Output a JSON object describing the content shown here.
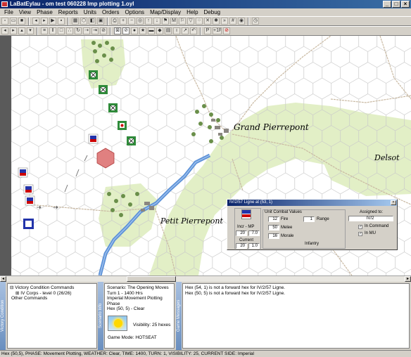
{
  "window": {
    "title": "LaBatEylau - om test 060228 Imp plotting 1.oyl"
  },
  "menu": [
    "File",
    "View",
    "Phase",
    "Reports",
    "Units",
    "Orders",
    "Options",
    "Map/Display",
    "Help",
    "Debug"
  ],
  "toolbar2": {
    "p_label": "P",
    "plus_label": "+1P"
  },
  "map": {
    "places": [
      {
        "name": "Grand Pierrepont"
      },
      {
        "name": "Petit Pierrepont"
      },
      {
        "name": "Delsot"
      }
    ],
    "colors": {
      "hex_bg": "#ffffff",
      "hex_line": "#c8c8c8",
      "woods": "#e2efc6",
      "river": "#5f93d8",
      "road": "#c9b9a2",
      "unit_green": "#2f8b3a",
      "french_blue": "#2233aa",
      "hex_highlight": "#e08080"
    }
  },
  "unit_dialog": {
    "title": "IV/2/57 Ligne at (53, 1)",
    "combat_values_label": "Unit Combat Values",
    "fire_value": "12",
    "fire_label": "Fire",
    "range_value": "1",
    "range_label": "Range",
    "melee_value": "50",
    "melee_label": "Melee",
    "morale_value": "16",
    "morale_label": "Morale",
    "type_label": "Infantry",
    "incr_mp_label": "Incr - MP",
    "incr_value": "20",
    "mp_value": "7.0",
    "current_label": "Current",
    "current_value": "20",
    "current_mp_value": "1.0",
    "assigned_label": "Assigned to:",
    "assigned_value": "IV/2",
    "in_command_label": "In Command",
    "in_mu_label": "In MU"
  },
  "bottom": {
    "vc_tab": "Victory Condition",
    "scenario_tab": "Scenario Info",
    "msg_tab": "Game Messages",
    "victory_tree": {
      "root": "Victory Condition Commands",
      "child": "IV Corps - level 0 (26/26)",
      "other": "Other Commands"
    },
    "scenario": {
      "name": "Scenario: The Opening Moves",
      "turn": "Turn 1 - 1400 Hrs",
      "phase": "Imperial Movement Plotting Phase",
      "hex": "Hex (50, 5) - Clear",
      "visibility": "Visibility: 25 hexes",
      "mode": "Game Mode: HOTSEAT"
    },
    "messages": [
      "Hex (54, 1) is not a forward hex for IV/2/57 Ligne.",
      "Hex (50, 5) is not a forward hex for IV/2/57 Ligne."
    ]
  },
  "status_bar": "Hex (50,5), PHASE: Movement Plotting, WEATHER: Clear, TIME: 1400, TURN: 1, VISIBILITY: 25, CURRENT SIDE: Imperial"
}
